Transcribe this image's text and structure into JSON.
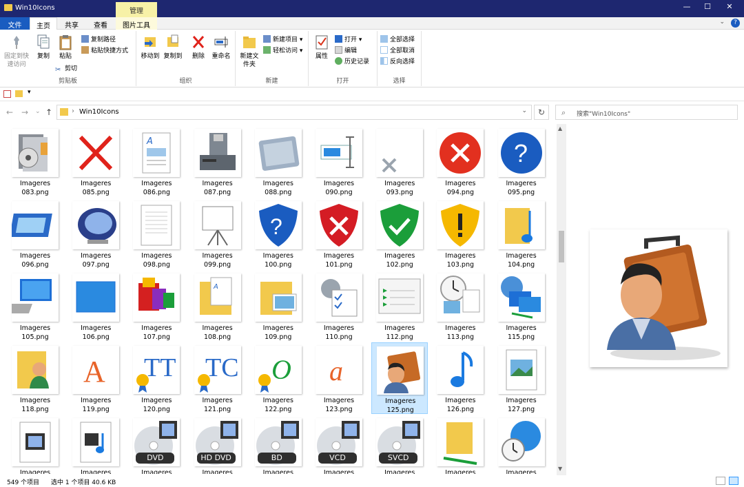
{
  "window": {
    "title": "Win10Icons",
    "context_tab": "管理",
    "minimize": "—",
    "maximize": "☐",
    "close": "✕"
  },
  "menu": {
    "file": "文件",
    "home": "主页",
    "share": "共享",
    "view": "查看",
    "tools": "图片工具",
    "collapse": "⌄",
    "help": "?"
  },
  "ribbon": {
    "clipboard": {
      "label": "剪贴板",
      "pin": "固定到快速访问",
      "copy": "复制",
      "paste": "粘贴",
      "copy_path": "复制路径",
      "paste_shortcut": "粘贴快捷方式",
      "cut": "剪切"
    },
    "organize": {
      "label": "组织",
      "move_to": "移动到",
      "copy_to": "复制到",
      "delete": "删除",
      "rename": "重命名"
    },
    "new": {
      "label": "新建",
      "new_folder": "新建文件夹",
      "new_item": "新建项目",
      "easy_access": "轻松访问"
    },
    "open": {
      "label": "打开",
      "properties": "属性",
      "open": "打开",
      "edit": "编辑",
      "history": "历史记录"
    },
    "select": {
      "label": "选择",
      "select_all": "全部选择",
      "select_none": "全部取消",
      "invert": "反向选择"
    }
  },
  "address": {
    "path": "Win10Icons",
    "search_placeholder": "搜索\"Win10Icons\"",
    "back": "←",
    "forward": "→",
    "recent": "⌄",
    "up": "↑",
    "dropdown": "⌄",
    "refresh": "↻",
    "separator": "›",
    "search_icon": "⌕"
  },
  "files": [
    {
      "line1": "Imageres",
      "line2": "083.png",
      "icon": "cd-box-icon"
    },
    {
      "line1": "Imageres",
      "line2": "085.png",
      "icon": "red-x-icon"
    },
    {
      "line1": "Imageres",
      "line2": "086.png",
      "icon": "document-icon"
    },
    {
      "line1": "Imageres",
      "line2": "087.png",
      "icon": "floppy-drive-icon"
    },
    {
      "line1": "Imageres",
      "line2": "088.png",
      "icon": "drive-icon"
    },
    {
      "line1": "Imageres",
      "line2": "090.png",
      "icon": "textbox-icon"
    },
    {
      "line1": "Imageres",
      "line2": "093.png",
      "icon": "gray-x-icon"
    },
    {
      "line1": "Imageres",
      "line2": "094.png",
      "icon": "error-circle-icon"
    },
    {
      "line1": "Imageres",
      "line2": "095.png",
      "icon": "help-circle-icon"
    },
    {
      "line1": "Imageres",
      "line2": "096.png",
      "icon": "screen-icon"
    },
    {
      "line1": "Imageres",
      "line2": "097.png",
      "icon": "monitor-icon"
    },
    {
      "line1": "Imageres",
      "line2": "098.png",
      "icon": "blank-doc-icon"
    },
    {
      "line1": "Imageres",
      "line2": "099.png",
      "icon": "projector-icon"
    },
    {
      "line1": "Imageres",
      "line2": "100.png",
      "icon": "shield-help-icon"
    },
    {
      "line1": "Imageres",
      "line2": "101.png",
      "icon": "shield-error-icon"
    },
    {
      "line1": "Imageres",
      "line2": "102.png",
      "icon": "shield-ok-icon"
    },
    {
      "line1": "Imageres",
      "line2": "103.png",
      "icon": "shield-warning-icon"
    },
    {
      "line1": "Imageres",
      "line2": "104.png",
      "icon": "music-folder-icon"
    },
    {
      "line1": "Imageres",
      "line2": "105.png",
      "icon": "computer-icon"
    },
    {
      "line1": "Imageres",
      "line2": "106.png",
      "icon": "desktop-icon"
    },
    {
      "line1": "Imageres",
      "line2": "107.png",
      "icon": "blocks-icon"
    },
    {
      "line1": "Imageres",
      "line2": "108.png",
      "icon": "documents-folder-icon"
    },
    {
      "line1": "Imageres",
      "line2": "109.png",
      "icon": "pictures-folder-icon"
    },
    {
      "line1": "Imageres",
      "line2": "110.png",
      "icon": "settings-checklist-icon"
    },
    {
      "line1": "Imageres",
      "line2": "112.png",
      "icon": "list-window-icon"
    },
    {
      "line1": "Imageres",
      "line2": "113.png",
      "icon": "clock-pictures-icon"
    },
    {
      "line1": "Imageres",
      "line2": "115.png",
      "icon": "network-icon"
    },
    {
      "line1": "Imageres",
      "line2": "118.png",
      "icon": "user-folder-icon"
    },
    {
      "line1": "Imageres",
      "line2": "119.png",
      "icon": "font-a-icon"
    },
    {
      "line1": "Imageres",
      "line2": "120.png",
      "icon": "font-tt-icon"
    },
    {
      "line1": "Imageres",
      "line2": "121.png",
      "icon": "font-tc-icon"
    },
    {
      "line1": "Imageres",
      "line2": "122.png",
      "icon": "font-o-icon"
    },
    {
      "line1": "Imageres",
      "line2": "123.png",
      "icon": "font-a-italic-icon"
    },
    {
      "line1": "Imageres",
      "line2": "125.png",
      "icon": "user-briefcase-icon"
    },
    {
      "line1": "Imageres",
      "line2": "126.png",
      "icon": "music-note-icon"
    },
    {
      "line1": "Imageres",
      "line2": "127.png",
      "icon": "picture-doc-icon"
    },
    {
      "line1": "Imageres",
      "line2": "",
      "icon": "video-doc-icon"
    },
    {
      "line1": "Imageres",
      "line2": "",
      "icon": "video-music-doc-icon"
    },
    {
      "line1": "Imageres",
      "line2": "",
      "icon": "dvd-icon",
      "disc_label": "DVD"
    },
    {
      "line1": "Imageres",
      "line2": "",
      "icon": "hddvd-icon",
      "disc_label": "HD DVD"
    },
    {
      "line1": "Imageres",
      "line2": "",
      "icon": "bd-icon",
      "disc_label": "BD"
    },
    {
      "line1": "Imageres",
      "line2": "",
      "icon": "vcd-icon",
      "disc_label": "VCD"
    },
    {
      "line1": "Imageres",
      "line2": "",
      "icon": "svcd-icon",
      "disc_label": "SVCD"
    },
    {
      "line1": "Imageres",
      "line2": "",
      "icon": "network-folder-icon"
    },
    {
      "line1": "Imageres",
      "line2": "",
      "icon": "globe-clock-icon"
    }
  ],
  "selected_index": 33,
  "status": {
    "count": "549 个项目",
    "selection": "选中 1 个项目  40.6 KB"
  },
  "scroll": {
    "up": "▲",
    "down": "▼"
  },
  "colors": {
    "titlebar": "#1e2770",
    "accent": "#1a5cc0",
    "selection": "#cce8ff"
  }
}
